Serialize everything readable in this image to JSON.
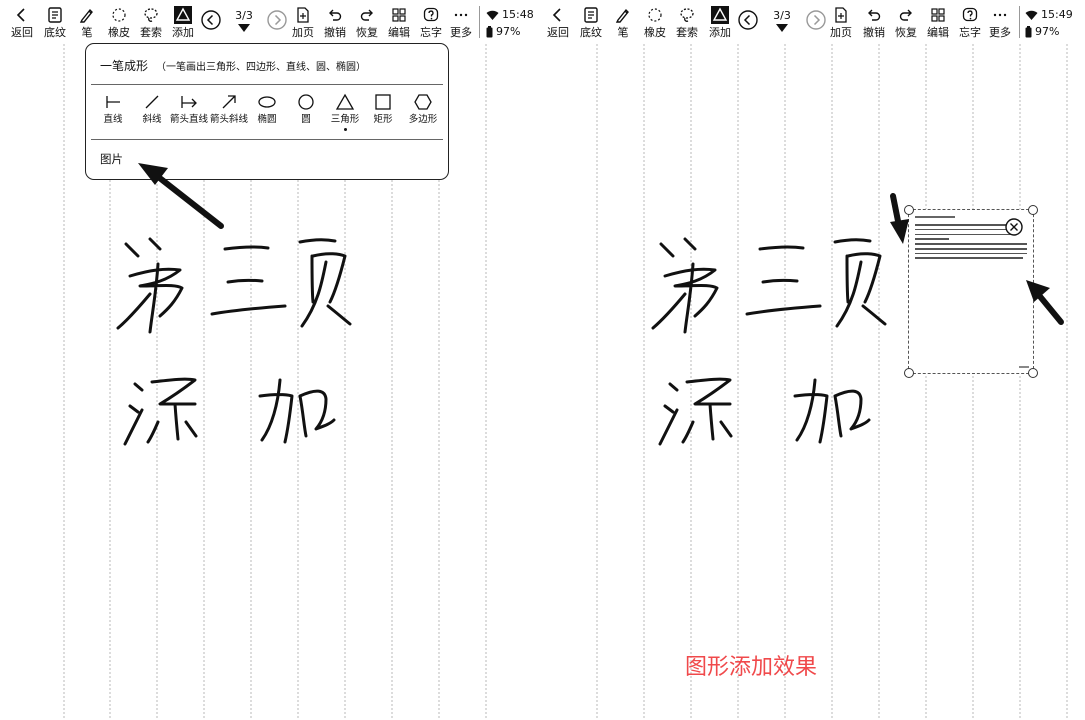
{
  "toolbar": {
    "back_label": "返回",
    "background_label": "底纹",
    "pen_label": "笔",
    "eraser_label": "橡皮",
    "lasso_label": "套索",
    "add_label": "添加",
    "add_page_label": "加页",
    "undo_label": "撤销",
    "redo_label": "恢复",
    "edit_label": "编辑",
    "ocr_label": "忘字",
    "more_label": "更多"
  },
  "left": {
    "page_indicator": "3/3",
    "time": "15:48",
    "battery": "97%",
    "popup": {
      "title": "一笔成形",
      "hint": "（一笔画出三角形、四边形、直线、圆、椭圆）",
      "shapes": [
        {
          "label": "直线",
          "icon": "vertical-bar-line-icon"
        },
        {
          "label": "斜线",
          "icon": "slash-line-icon"
        },
        {
          "label": "箭头直线",
          "icon": "arrow-straight-icon"
        },
        {
          "label": "箭头斜线",
          "icon": "arrow-diagonal-icon"
        },
        {
          "label": "椭圆",
          "icon": "ellipse-icon"
        },
        {
          "label": "圆",
          "icon": "circle-icon"
        },
        {
          "label": "三角形",
          "icon": "triangle-icon",
          "selected": true
        },
        {
          "label": "矩形",
          "icon": "rectangle-icon"
        },
        {
          "label": "多边形",
          "icon": "hexagon-icon"
        }
      ],
      "image_label": "图片"
    }
  },
  "right": {
    "page_indicator": "3/3",
    "time": "15:49",
    "battery": "97%",
    "caption": "图形添加效果"
  },
  "colors": {
    "caption": "#f0494b",
    "ink": "#111111",
    "guide_lines": "#b8b8b8"
  }
}
